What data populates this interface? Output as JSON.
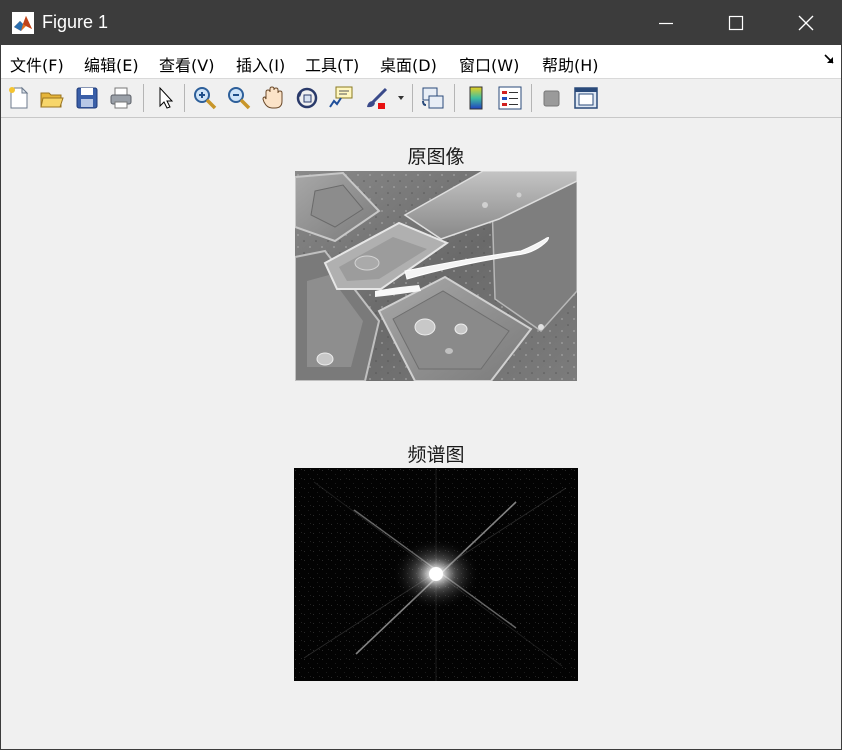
{
  "window": {
    "title": "Figure 1",
    "min_icon": "minimize-icon",
    "max_icon": "maximize-icon",
    "close_icon": "close-icon"
  },
  "menu": [
    {
      "label": "文件(F)"
    },
    {
      "label": "编辑(E)"
    },
    {
      "label": "查看(V)"
    },
    {
      "label": "插入(I)"
    },
    {
      "label": "工具(T)"
    },
    {
      "label": "桌面(D)"
    },
    {
      "label": "窗口(W)"
    },
    {
      "label": "帮助(H)"
    }
  ],
  "toolbar": {
    "icons": [
      "new-figure-icon",
      "open-icon",
      "save-icon",
      "print-icon",
      "pointer-icon",
      "zoom-in-icon",
      "zoom-out-icon",
      "pan-hand-icon",
      "rotate-3d-icon",
      "data-cursor-icon",
      "brush-icon",
      "brush-dropdown-icon",
      "link-plot-icon",
      "colorbar-icon",
      "legend-icon",
      "hide-plot-tools-icon",
      "show-plot-tools-icon"
    ]
  },
  "plots": {
    "top_title": "原图像",
    "bottom_title": "频谱图"
  }
}
